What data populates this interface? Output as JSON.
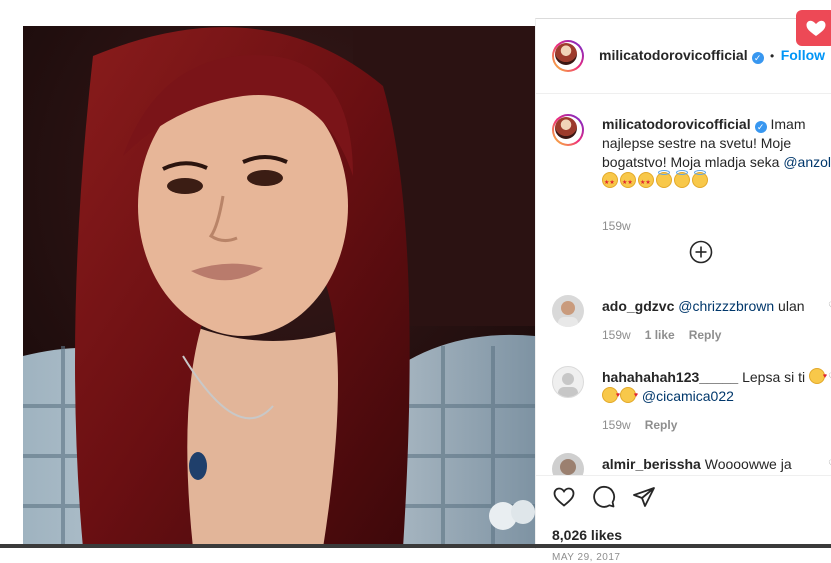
{
  "post": {
    "username": "milicatodorovicofficial",
    "verified": true,
    "follow_label": "Follow",
    "separator": "•"
  },
  "caption": {
    "username": "milicatodorovicofficial",
    "text": "Imam najlepse sestre na svetu! Moje bogatstvo! Moja mladja seka",
    "mention": "@anzoli",
    "emojis": [
      "star-struck-emoji",
      "star-struck-emoji",
      "star-struck-emoji",
      "smiling-halo-emoji",
      "smiling-halo-emoji",
      "smiling-halo-emoji"
    ],
    "age": "159w"
  },
  "load_more_icon": "plus-circle-icon",
  "comments": [
    {
      "username": "ado_gdzvc",
      "mention": "@chrizzzbrown",
      "text": " ulan",
      "age": "159w",
      "likes": "1 like",
      "reply": "Reply"
    },
    {
      "username": "hahahahah123_____",
      "text_before": " Lepsa si ti",
      "mention": "@cicamica022",
      "age": "159w",
      "reply": "Reply"
    },
    {
      "username": "almir_berissha",
      "text": " Woooowwe ja"
    }
  ],
  "actions": {
    "like_icon": "heart-outline-icon",
    "comment_icon": "comment-bubble-icon",
    "share_icon": "paper-plane-icon",
    "likes": "8,026 likes",
    "date": "MAY 29, 2017"
  },
  "colors": {
    "accent": "#0095f6",
    "notification": "#ed4956",
    "muted": "#8e8e8e",
    "text": "#262626"
  }
}
